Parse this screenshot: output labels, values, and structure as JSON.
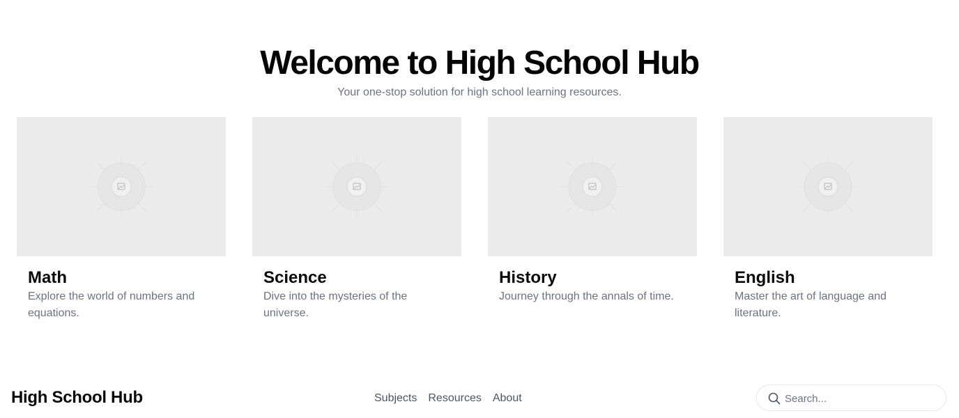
{
  "hero": {
    "title": "Welcome to High School Hub",
    "subtitle": "Your one-stop solution for high school learning resources."
  },
  "subjects": [
    {
      "title": "Math",
      "description": "Explore the world of numbers and equations.",
      "icon": "image-placeholder-icon"
    },
    {
      "title": "Science",
      "description": "Dive into the mysteries of the universe.",
      "icon": "image-placeholder-icon"
    },
    {
      "title": "History",
      "description": "Journey through the annals of time.",
      "icon": "image-placeholder-icon"
    },
    {
      "title": "English",
      "description": "Master the art of language and literature.",
      "icon": "image-placeholder-icon"
    }
  ],
  "navbar": {
    "brand": "High School Hub",
    "links": [
      {
        "label": "Subjects"
      },
      {
        "label": "Resources"
      },
      {
        "label": "About"
      }
    ],
    "search": {
      "placeholder": "Search...",
      "value": "",
      "icon": "search-icon"
    }
  },
  "colors": {
    "background": "#ffffff",
    "text": "#0a0a0a",
    "muted": "#6b7280",
    "placeholder_bg": "#ebebeb",
    "border": "#e5e7eb"
  }
}
